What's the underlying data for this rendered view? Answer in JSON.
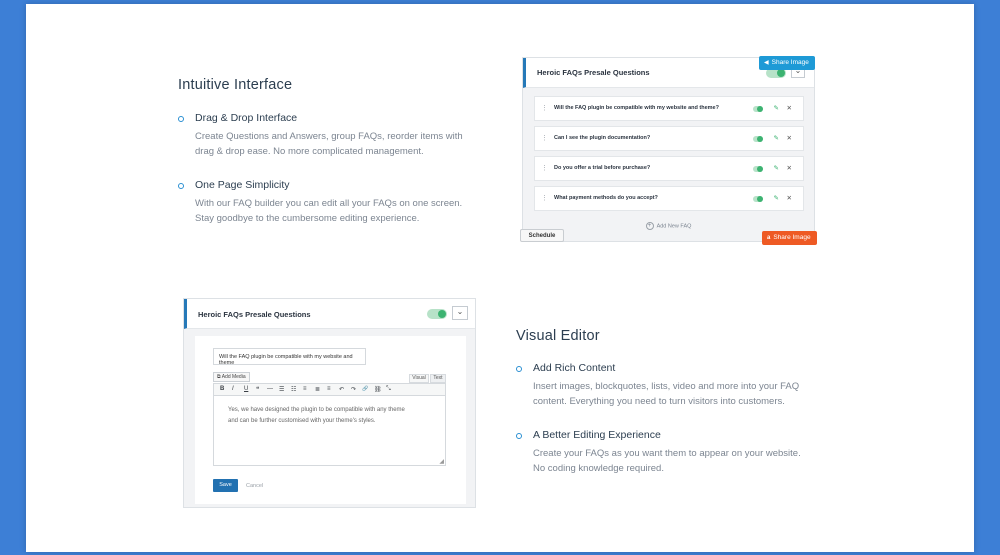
{
  "section1": {
    "heading": "Intuitive Interface",
    "items": [
      {
        "title": "Drag & Drop Interface",
        "line1": "Create Questions and Answers, group FAQs, reorder items with",
        "line2": "drag & drop ease. No more complicated management."
      },
      {
        "title": "One Page Simplicity",
        "line1": "With our FAQ builder you can edit all your FAQs on one screen.",
        "line2": "Stay goodbye to the cumbersome editing experience."
      }
    ]
  },
  "section2": {
    "heading": "Visual Editor",
    "items": [
      {
        "title": "Add Rich Content",
        "line1": "Insert images, blockquotes, lists, video and more into your FAQ",
        "line2": "content. Everything you need to turn visitors into customers."
      },
      {
        "title": "A Better Editing Experience",
        "line1": "Create your FAQs as you want them to appear on your website.",
        "line2": "No coding knowledge required."
      }
    ]
  },
  "builder": {
    "group_title": "Heroic FAQs Presale Questions",
    "chevron": "⌄",
    "faqs": [
      "Will the FAQ plugin be compatible with my website and theme?",
      "Can I see the plugin documentation?",
      "Do you offer a trial before purchase?",
      "What payment methods do you accept?"
    ],
    "grip": "⋮",
    "edit_glyph": "✎",
    "delete_glyph": "✕",
    "add_label": "Add New FAQ",
    "schedule_label": "Schedule"
  },
  "share_top": {
    "label": "Share Image",
    "icon": "◀",
    "color": "#1e9ad6"
  },
  "share_bottom": {
    "label": "Share Image",
    "icon": "a",
    "color": "#ee5a24"
  },
  "editor": {
    "group_title": "Heroic FAQs Presale Questions",
    "chevron": "⌄",
    "question_value": "Will the FAQ plugin be compatible with my website and theme",
    "add_media_label": "Add Media",
    "tab_visual": "Visual",
    "tab_text": "Text",
    "toolbar": [
      "B",
      "I",
      "U",
      "❝",
      "—",
      "☰",
      "☷",
      "≡",
      "≣",
      "≡",
      "↶",
      "↷",
      "🔗",
      "⛓",
      "⤡"
    ],
    "content_line1": "Yes, we have designed the plugin to be compatible with any theme",
    "content_line2": "and can be further customised with your theme's styles.",
    "save_label": "Save",
    "cancel_label": "Cancel"
  }
}
